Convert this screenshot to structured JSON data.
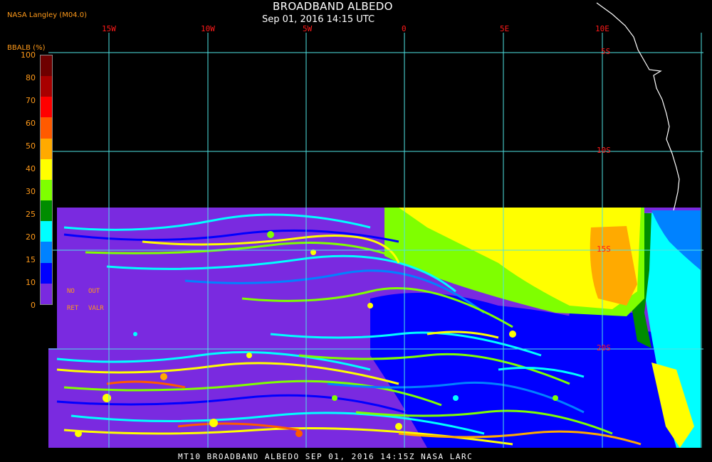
{
  "header": {
    "title": "BROADBAND ALBEDO",
    "timestamp": "Sep 01, 2016 14:15 UTC",
    "source": "NASA Langley (M04.0)"
  },
  "footer": {
    "caption": "MT10  BROADBAND ALBEDO  SEP 01, 2016 14:15Z  NASA LARC"
  },
  "grid": {
    "longitudes": [
      "15W",
      "10W",
      "5W",
      "0",
      "5E",
      "10E"
    ],
    "latitudes": [
      "5S",
      "10S",
      "15S",
      "20S"
    ],
    "line_color": "#4fe3e3"
  },
  "legend": {
    "title": "BBALB (%)",
    "ticks": [
      "100",
      "80",
      "70",
      "60",
      "50",
      "40",
      "30",
      "25",
      "20",
      "15",
      "10",
      "0"
    ],
    "colors": [
      "#6e0000",
      "#a80000",
      "#ff0000",
      "#ff5a00",
      "#ffaa00",
      "#ffff00",
      "#7fff00",
      "#008c00",
      "#00ffff",
      "#0082ff",
      "#0000ff",
      "#7a2ae0"
    ],
    "no_ret_label": "NO",
    "no_ret_label2": "RET",
    "out_label": "OUT",
    "out_label2": "VALR"
  },
  "palette": {
    "purple": "#7a2ae0",
    "blue": "#0000ff",
    "light_blue": "#0082ff",
    "cyan": "#00ffff",
    "dark_green": "#008c00",
    "green": "#7fff00",
    "yellow": "#ffff00",
    "orange": "#ffaa00",
    "coastline": "#ffffff"
  }
}
